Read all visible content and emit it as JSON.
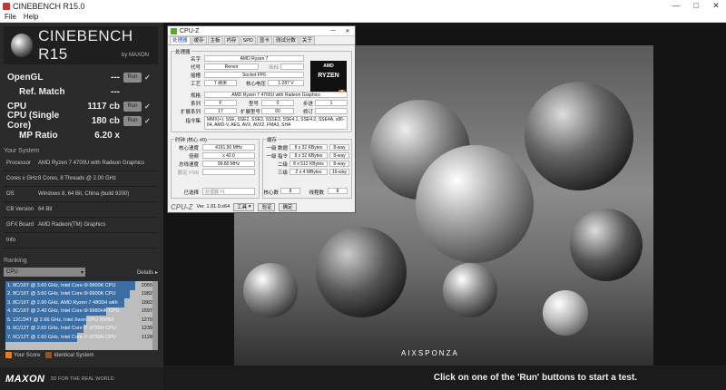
{
  "window": {
    "title": "CINEBENCH R15.0",
    "controls": [
      "—",
      "□",
      "✕"
    ]
  },
  "menu": [
    "File",
    "Help"
  ],
  "logo": {
    "name": "CINEBENCH R15",
    "by": "by MAXON"
  },
  "scores": [
    {
      "label": "OpenGL",
      "value": "---",
      "run": "Run",
      "indent": false
    },
    {
      "label": "Ref. Match",
      "value": "---",
      "run": "",
      "indent": true
    },
    {
      "label": "CPU",
      "value": "1117 cb",
      "run": "Run",
      "indent": false
    },
    {
      "label": "CPU (Single Core)",
      "value": "180 cb",
      "run": "Run",
      "indent": false
    },
    {
      "label": "MP Ratio",
      "value": "6.20 x",
      "run": "",
      "indent": true
    }
  ],
  "your_system": {
    "title": "Your System",
    "rows": [
      {
        "k": "Processor",
        "v": "AMD Ryzen 7 4700U with Radeon Graphics"
      },
      {
        "k": "Cores x GHz",
        "v": "8 Cores, 8 Threads @ 2.00 GHz"
      },
      {
        "k": "OS",
        "v": "Windows 8, 64 Bit, China (build 9200)"
      },
      {
        "k": "CB Version",
        "v": "64 Bit"
      },
      {
        "k": "GFX Board",
        "v": "AMD Radeon(TM) Graphics"
      },
      {
        "k": "Info",
        "v": ""
      }
    ]
  },
  "ranking": {
    "title": "Ranking",
    "select": "CPU",
    "details": "Details",
    "items": [
      {
        "text": "1. 8C/16T @ 3.60 GHz, Intel Core i9-9900K CPU",
        "score": "2055",
        "fill": 1.0
      },
      {
        "text": "2. 8C/16T @ 3.60 GHz, Intel Core i9-9900K CPU",
        "score": "1982",
        "fill": 0.96
      },
      {
        "text": "3. 8C/16T @ 2.90 GHz, AMD Ryzen 7 4800H with",
        "score": "1882",
        "fill": 0.92
      },
      {
        "text": "4. 8C/16T @ 2.40 GHz, Intel Core i9-9980HK CPU",
        "score": "1597",
        "fill": 0.78
      },
      {
        "text": "5. 12C/24T @ 2.66 GHz, Intel Xeon CPU X5650",
        "score": "1279",
        "fill": 0.62
      },
      {
        "text": "6. 6C/12T @ 2.60 GHz, Intel Core i7-9750H CPU",
        "score": "1239",
        "fill": 0.6
      },
      {
        "text": "7. 6C/12T @ 2.60 GHz, Intel Core i7-9750H CPU",
        "score": "1128",
        "fill": 0.55
      }
    ],
    "legend": {
      "your": "Your Score",
      "identical": "Identical System"
    }
  },
  "footer": {
    "brand": "MAXON",
    "tagline": "3D FOR THE REAL WORLD"
  },
  "status": "Click on one of the 'Run' buttons to start a test.",
  "render": {
    "credit": "AIXSPONZA"
  },
  "cpuz": {
    "title": "CPU-Z",
    "tabs": [
      "处理器",
      "缓存",
      "主板",
      "内存",
      "SPD",
      "显卡",
      "测试分数",
      "关于"
    ],
    "group_processor": "处理器",
    "name_label": "名字",
    "name": "AMD Ryzen 7",
    "code_label": "代号",
    "code": "Renoir",
    "brand_label": "商标",
    "socket_label": "插槽",
    "socket": "Socket FP6",
    "tech_label": "工艺",
    "tech": "7 纳米",
    "vcore_label": "核心电压",
    "vcore": "1.287 V",
    "spec_label": "规格",
    "spec": "AMD Ryzen 7 4700U with Radeon Graphics",
    "family_label": "系列",
    "family": "F",
    "model_label": "型号",
    "model": "0",
    "stepping_label": "步进",
    "stepping": "1",
    "extfam_label": "扩展系列",
    "extfam": "17",
    "extmodel_label": "扩展型号",
    "extmodel": "60",
    "rev_label": "修订",
    "rev": "",
    "instr_label": "指令集",
    "instr": "MMX(+), SSE, SSE2, SSE3, SSSE3, SSE4.1, SSE4.2, SSE4A, x86-64, AMD-V, AES, AVX, AVX2, FMA3, SHA",
    "clock_group": "时钟 (核心 #0)",
    "core_speed_label": "核心速度",
    "core_speed": "4191.50 MHz",
    "mult_label": "倍频",
    "mult": "x 42.0",
    "bus_label": "总线速度",
    "bus": "99.80 MHz",
    "fsb_label": "额定 FSB",
    "cache_group": "缓存",
    "l1d_label": "一级 数据",
    "l1d": "8 x 32 KBytes",
    "l1d_way": "8-way",
    "l1i_label": "一级 指令",
    "l1i": "8 x 32 KBytes",
    "l1i_way": "8-way",
    "l2_label": "二级",
    "l2": "8 x 512 KBytes",
    "l2_way": "8-way",
    "l3_label": "三级",
    "l3": "2 x 4 MBytes",
    "l3_way": "16-way",
    "selected_label": "已选择",
    "selected": "处理器 #1",
    "cores_label": "核心数",
    "cores": "8",
    "threads_label": "线程数",
    "threads": "8",
    "logo": "CPU-Z",
    "version": "Ver. 1.91.0.x64",
    "tools": "工具",
    "validate": "验证",
    "ok": "确定",
    "ryzen_brand": "AMD",
    "ryzen_name": "RYZEN",
    "ryzen_num": "7"
  }
}
